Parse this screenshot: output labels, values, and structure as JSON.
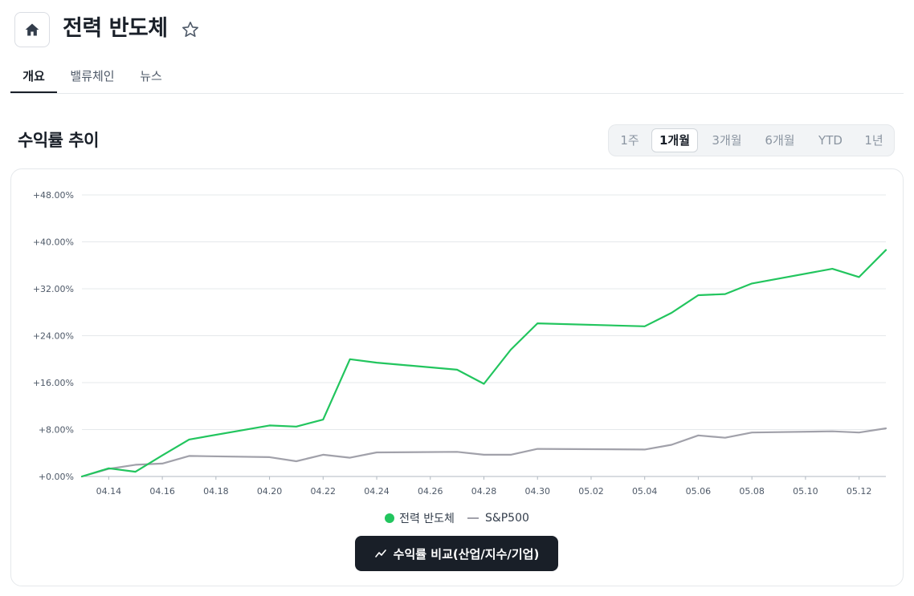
{
  "header": {
    "title": "전력 반도체"
  },
  "tabs": [
    {
      "label": "개요",
      "active": true
    },
    {
      "label": "밸류체인",
      "active": false
    },
    {
      "label": "뉴스",
      "active": false
    }
  ],
  "section": {
    "title": "수익률 추이"
  },
  "periods": [
    {
      "label": "1주",
      "active": false
    },
    {
      "label": "1개월",
      "active": true
    },
    {
      "label": "3개월",
      "active": false
    },
    {
      "label": "6개월",
      "active": false
    },
    {
      "label": "YTD",
      "active": false
    },
    {
      "label": "1년",
      "active": false
    }
  ],
  "chart_data": {
    "type": "line",
    "title": "",
    "xlabel": "",
    "ylabel": "",
    "ylim": [
      0,
      48
    ],
    "yticks": [
      0,
      8,
      16,
      24,
      32,
      40,
      48
    ],
    "ytick_labels": [
      "+0.00%",
      "+8.00%",
      "+16.00%",
      "+24.00%",
      "+32.00%",
      "+40.00%",
      "+48.00%"
    ],
    "xlim": [
      "2025-04-13",
      "2025-05-13"
    ],
    "xtick_labels": [
      "04.14",
      "04.16",
      "04.18",
      "04.20",
      "04.22",
      "04.24",
      "04.26",
      "04.28",
      "04.30",
      "05.02",
      "05.04",
      "05.06",
      "05.08",
      "05.10",
      "05.12"
    ],
    "grid": true,
    "legend_position": "bottom-center",
    "x": [
      "2025-04-13",
      "2025-04-14",
      "2025-04-15",
      "2025-04-16",
      "2025-04-17",
      "2025-04-20",
      "2025-04-21",
      "2025-04-22",
      "2025-04-23",
      "2025-04-24",
      "2025-04-27",
      "2025-04-28",
      "2025-04-29",
      "2025-04-30",
      "2025-05-04",
      "2025-05-05",
      "2025-05-06",
      "2025-05-07",
      "2025-05-08",
      "2025-05-11",
      "2025-05-12",
      "2025-05-13"
    ],
    "series": [
      {
        "name": "전력 반도체",
        "color": "#22c55e",
        "values": [
          0,
          1.4,
          0.8,
          3.6,
          6.3,
          8.7,
          8.5,
          9.7,
          20.0,
          19.4,
          18.2,
          15.8,
          21.6,
          26.1,
          25.6,
          27.9,
          30.9,
          31.1,
          32.9,
          35.4,
          34.0,
          38.6
        ]
      },
      {
        "name": "S&P500",
        "color": "#a1a1aa",
        "values": [
          0,
          1.3,
          2.0,
          2.2,
          3.5,
          3.3,
          2.6,
          3.7,
          3.2,
          4.1,
          4.2,
          3.7,
          3.7,
          4.7,
          4.6,
          5.4,
          7.0,
          6.6,
          7.5,
          7.7,
          7.5,
          8.2
        ]
      }
    ]
  },
  "compare_button": {
    "label": "수익률 비교(산업/지수/기업)"
  }
}
